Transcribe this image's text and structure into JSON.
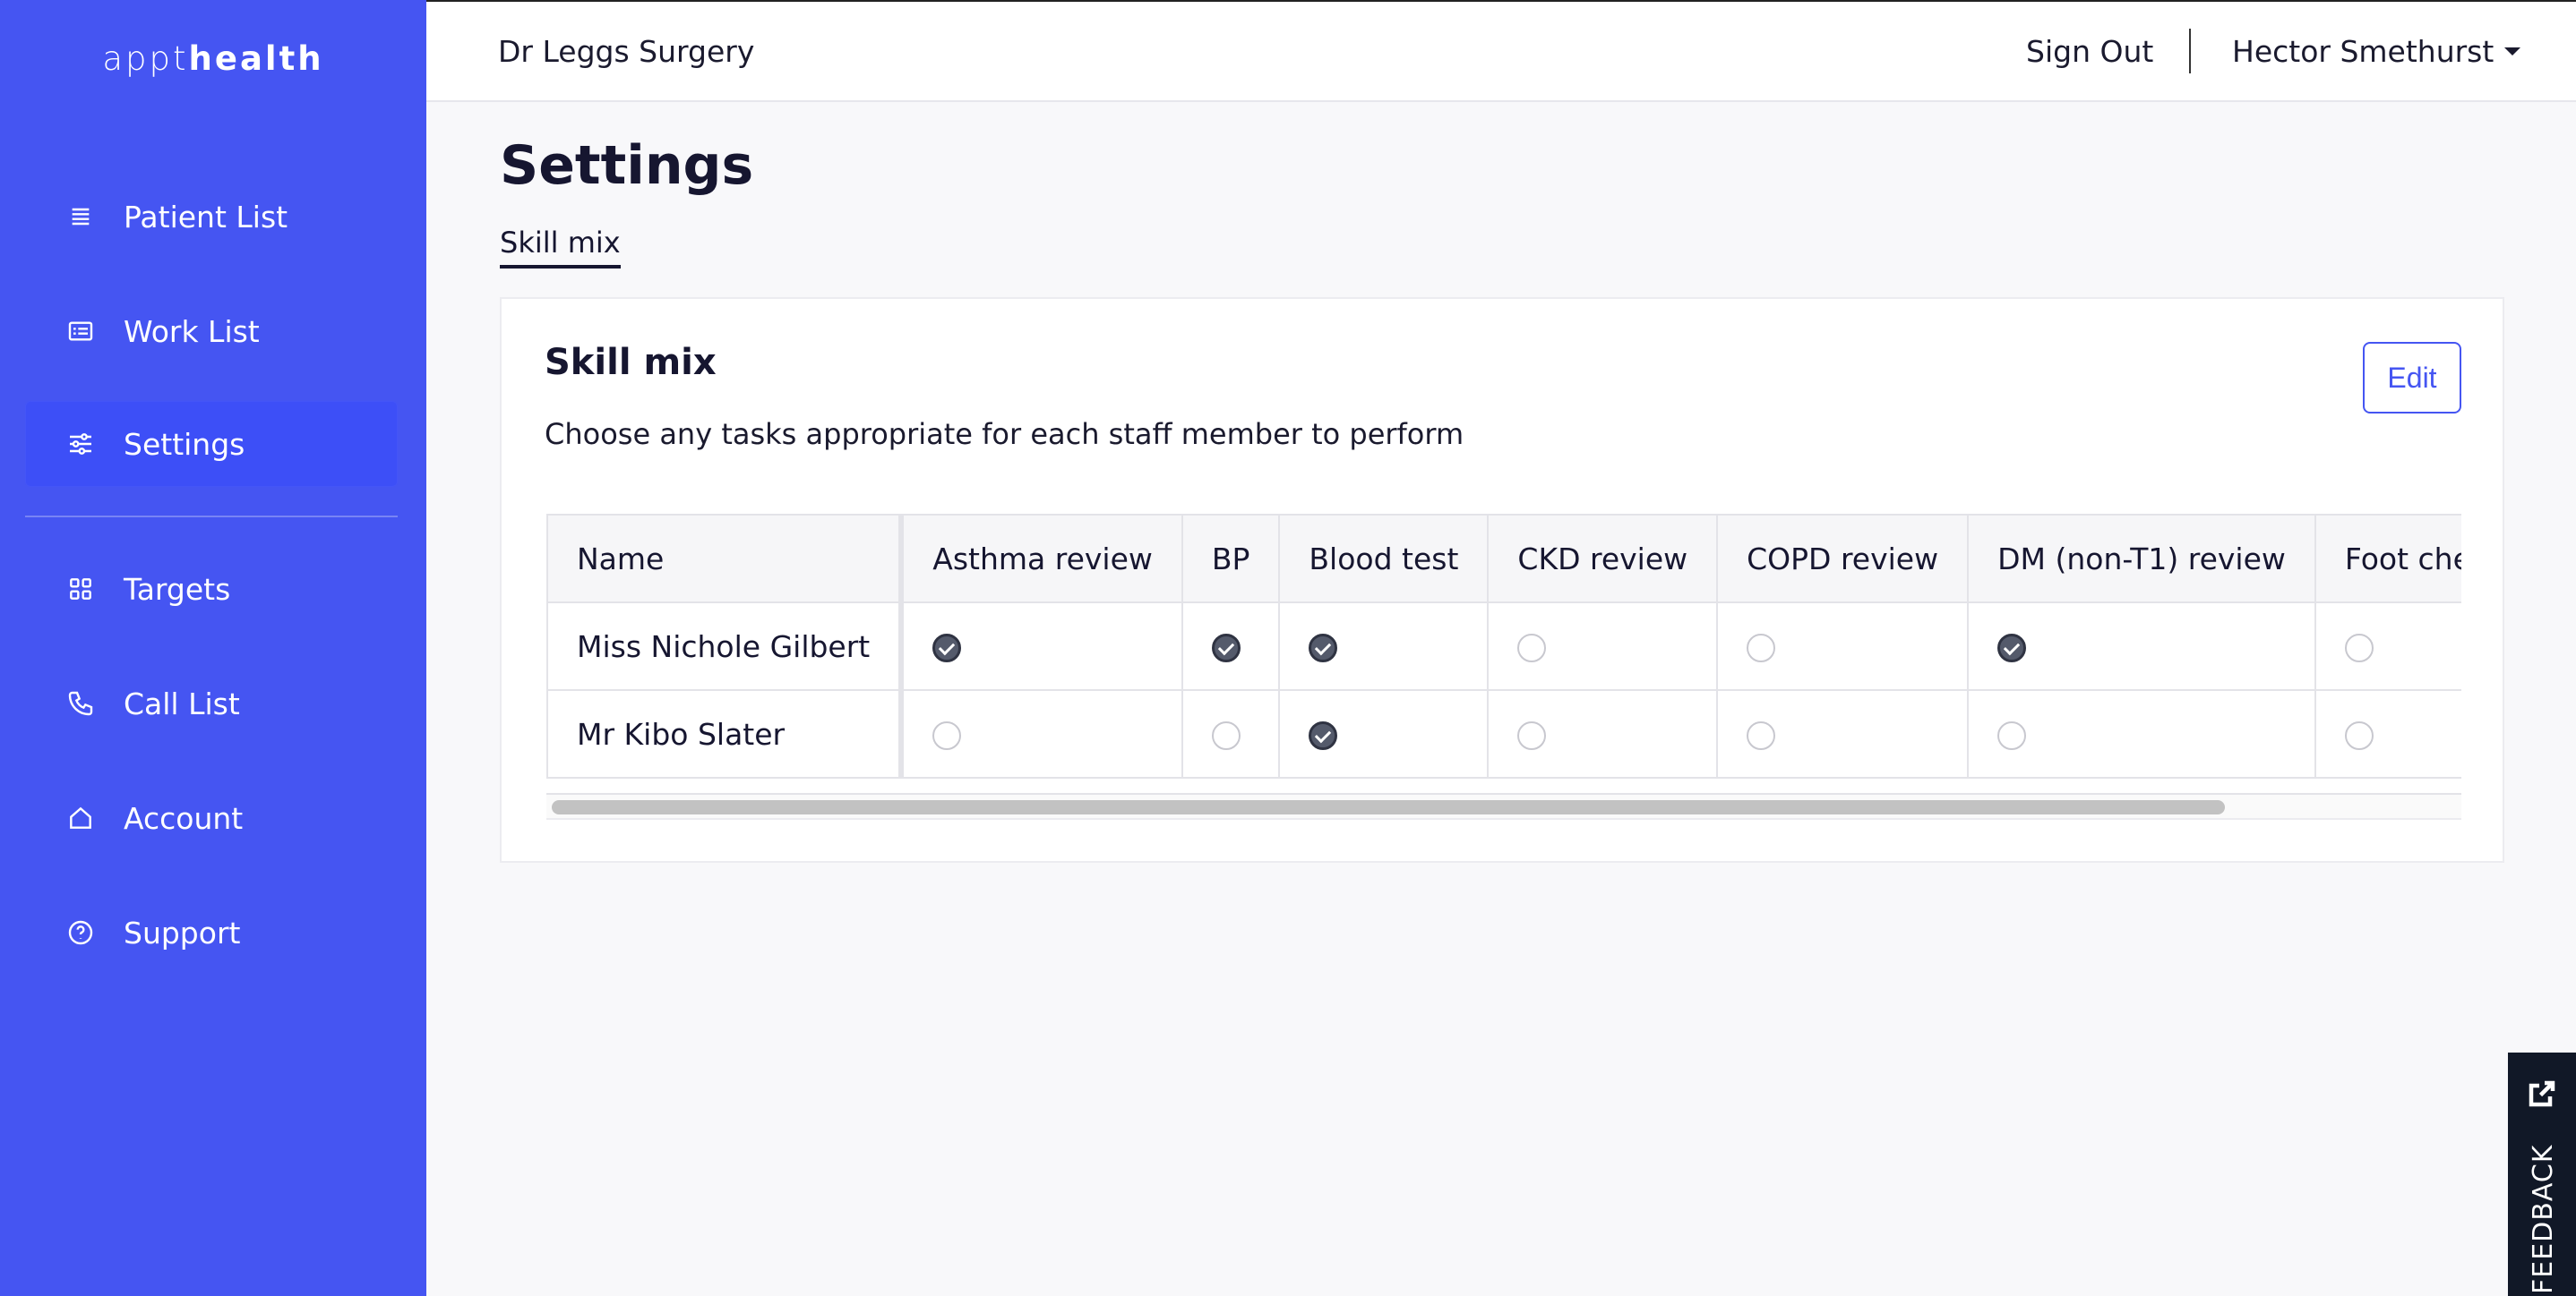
{
  "brand": {
    "light": "appt",
    "bold": "health"
  },
  "header": {
    "practice_name": "Dr Leggs Surgery",
    "sign_out": "Sign Out",
    "user_name": "Hector Smethurst"
  },
  "sidebar": {
    "items": [
      {
        "label": "Patient List",
        "icon": "list-icon",
        "active": false
      },
      {
        "label": "Work List",
        "icon": "id-card-icon",
        "active": false
      },
      {
        "label": "Settings",
        "icon": "sliders-icon",
        "active": true
      },
      {
        "label": "Targets",
        "icon": "grid-icon",
        "active": false
      },
      {
        "label": "Call List",
        "icon": "phone-icon",
        "active": false
      },
      {
        "label": "Account",
        "icon": "home-icon",
        "active": false
      },
      {
        "label": "Support",
        "icon": "help-circle-icon",
        "active": false
      }
    ]
  },
  "page": {
    "title": "Settings",
    "tabs": [
      {
        "label": "Skill mix",
        "active": true
      }
    ]
  },
  "skill_mix": {
    "title": "Skill mix",
    "description": "Choose any tasks appropriate for each staff member to perform",
    "edit_label": "Edit",
    "columns": [
      "Name",
      "Asthma review",
      "BP",
      "Blood test",
      "CKD review",
      "COPD review",
      "DM (non-T1) review",
      "Foot chec"
    ],
    "rows": [
      {
        "name": "Miss Nichole Gilbert",
        "checks": [
          true,
          true,
          true,
          false,
          false,
          true,
          false
        ]
      },
      {
        "name": "Mr Kibo Slater",
        "checks": [
          false,
          false,
          true,
          false,
          false,
          false,
          false
        ]
      }
    ]
  },
  "feedback": {
    "label": "FEEDBACK"
  },
  "colors": {
    "brand": "#4555f2",
    "checked": "#545a6b",
    "feedback_bg": "#111827"
  }
}
